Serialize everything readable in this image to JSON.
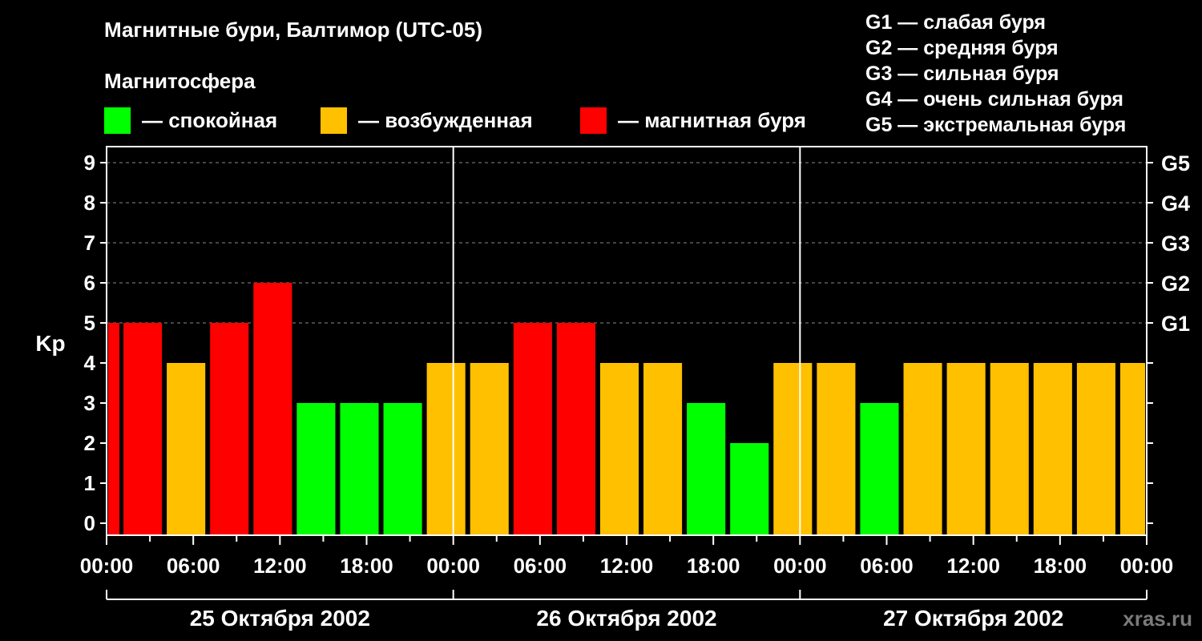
{
  "title": "Магнитные бури, Балтимор (UTC-05)",
  "legend": {
    "heading": "Магнитосфера",
    "items": [
      {
        "label": "— спокойная",
        "color": "#00ff00"
      },
      {
        "label": "— возбужденная",
        "color": "#ffc000"
      },
      {
        "label": "— магнитная буря",
        "color": "#ff0000"
      }
    ]
  },
  "storm_scale": [
    "G1 — слабая буря",
    "G2 — средняя буря",
    "G3 — сильная буря",
    "G4 — очень сильная буря",
    "G5 — экстремальная буря"
  ],
  "watermark": "xras.ru",
  "chart_data": {
    "type": "bar",
    "ylabel": "Kp",
    "ylim": [
      0,
      9
    ],
    "yticks": [
      "0",
      "1",
      "2",
      "3",
      "4",
      "5",
      "6",
      "7",
      "8",
      "9"
    ],
    "right_axis_labels": [
      {
        "kp": 5,
        "label": "G1"
      },
      {
        "kp": 6,
        "label": "G2"
      },
      {
        "kp": 7,
        "label": "G3"
      },
      {
        "kp": 8,
        "label": "G4"
      },
      {
        "kp": 9,
        "label": "G5"
      }
    ],
    "grid": "dashed horizontal",
    "xticks": [
      "00:00",
      "06:00",
      "12:00",
      "18:00",
      "00:00",
      "06:00",
      "12:00",
      "18:00",
      "00:00",
      "06:00",
      "12:00",
      "18:00",
      "00:00"
    ],
    "days": [
      "25 Октября 2002",
      "26 Октября 2002",
      "27 Октября 2002"
    ],
    "bars": [
      {
        "start_h": 0,
        "end_h": 1,
        "kp": 5
      },
      {
        "start_h": 1,
        "end_h": 4,
        "kp": 5
      },
      {
        "start_h": 4,
        "end_h": 7,
        "kp": 4
      },
      {
        "start_h": 7,
        "end_h": 10,
        "kp": 5
      },
      {
        "start_h": 10,
        "end_h": 13,
        "kp": 6
      },
      {
        "start_h": 13,
        "end_h": 16,
        "kp": 3
      },
      {
        "start_h": 16,
        "end_h": 19,
        "kp": 3
      },
      {
        "start_h": 19,
        "end_h": 22,
        "kp": 3
      },
      {
        "start_h": 22,
        "end_h": 25,
        "kp": 4
      },
      {
        "start_h": 25,
        "end_h": 28,
        "kp": 4
      },
      {
        "start_h": 28,
        "end_h": 31,
        "kp": 5
      },
      {
        "start_h": 31,
        "end_h": 34,
        "kp": 5
      },
      {
        "start_h": 34,
        "end_h": 37,
        "kp": 4
      },
      {
        "start_h": 37,
        "end_h": 40,
        "kp": 4
      },
      {
        "start_h": 40,
        "end_h": 43,
        "kp": 3
      },
      {
        "start_h": 43,
        "end_h": 46,
        "kp": 2
      },
      {
        "start_h": 46,
        "end_h": 49,
        "kp": 4
      },
      {
        "start_h": 49,
        "end_h": 52,
        "kp": 4
      },
      {
        "start_h": 52,
        "end_h": 55,
        "kp": 3
      },
      {
        "start_h": 55,
        "end_h": 58,
        "kp": 4
      },
      {
        "start_h": 58,
        "end_h": 61,
        "kp": 4
      },
      {
        "start_h": 61,
        "end_h": 64,
        "kp": 4
      },
      {
        "start_h": 64,
        "end_h": 67,
        "kp": 4
      },
      {
        "start_h": 67,
        "end_h": 70,
        "kp": 4
      },
      {
        "start_h": 70,
        "end_h": 72,
        "kp": 4
      }
    ],
    "colors": {
      "quiet": "#00ff00",
      "unsettled": "#ffc000",
      "storm": "#ff0000"
    }
  }
}
